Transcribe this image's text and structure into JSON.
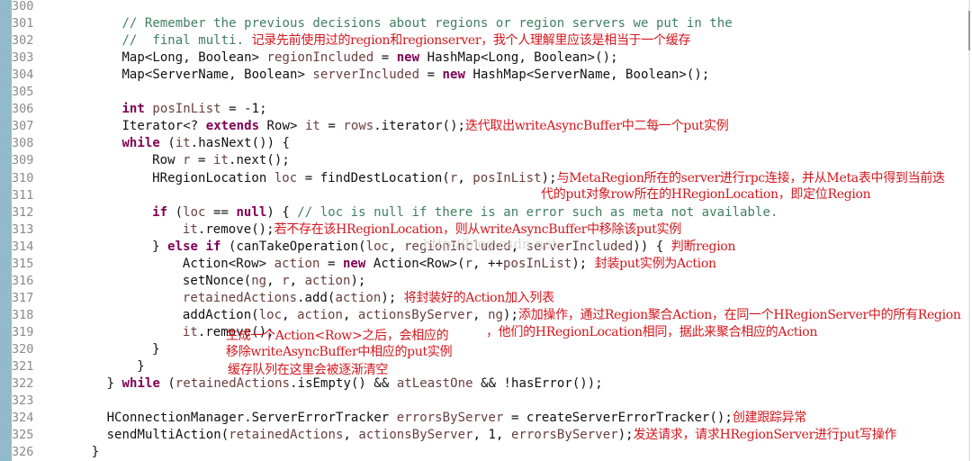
{
  "editor": {
    "watermark": "http://blog.csdn.net",
    "colors": {
      "keyword": "#7f0055",
      "comment": "#3f7f5f",
      "local_variable": "#6a3e3e",
      "annotation": "#d4161c",
      "line_number": "#8a8a8a"
    },
    "lines": [
      {
        "n": "300"
      },
      {
        "n": "301",
        "indent": "    ",
        "segs": [
          {
            "t": "// Remember the previous decisions about regions or region servers we put in the",
            "c": "cm"
          }
        ]
      },
      {
        "n": "302",
        "indent": "    ",
        "segs": [
          {
            "t": "//  final multi. ",
            "c": "cm"
          },
          {
            "t": "记录先前使用过的region和regionserver，我个人理解里应该是相当于一个缓存",
            "c": "note"
          }
        ]
      },
      {
        "n": "303",
        "indent": "    ",
        "segs": [
          {
            "t": "Map<Long, Boolean> "
          },
          {
            "t": "regionIncluded",
            "c": "var"
          },
          {
            "t": " = "
          },
          {
            "t": "new",
            "c": "kw"
          },
          {
            "t": " HashMap<Long, Boolean>();"
          }
        ]
      },
      {
        "n": "304",
        "indent": "    ",
        "segs": [
          {
            "t": "Map<ServerName, Boolean> "
          },
          {
            "t": "serverIncluded",
            "c": "var"
          },
          {
            "t": " = "
          },
          {
            "t": "new",
            "c": "kw"
          },
          {
            "t": " HashMap<ServerName, Boolean>();"
          }
        ]
      },
      {
        "n": "305"
      },
      {
        "n": "306",
        "indent": "    ",
        "segs": [
          {
            "t": "int",
            "c": "kw"
          },
          {
            "t": " "
          },
          {
            "t": "posInList",
            "c": "var"
          },
          {
            "t": " = -1;"
          }
        ]
      },
      {
        "n": "307",
        "indent": "    ",
        "segs": [
          {
            "t": "Iterator<? "
          },
          {
            "t": "extends",
            "c": "kw"
          },
          {
            "t": " Row> "
          },
          {
            "t": "it",
            "c": "var"
          },
          {
            "t": " = "
          },
          {
            "t": "rows",
            "c": "var"
          },
          {
            "t": ".iterator();"
          },
          {
            "t": "迭代取出writeAsyncBuffer中二每一个put实例",
            "c": "note"
          }
        ]
      },
      {
        "n": "308",
        "indent": "    ",
        "segs": [
          {
            "t": "while",
            "c": "kw"
          },
          {
            "t": " ("
          },
          {
            "t": "it",
            "c": "var"
          },
          {
            "t": ".hasNext()) {"
          }
        ]
      },
      {
        "n": "309",
        "indent": "      ",
        "segs": [
          {
            "t": "Row "
          },
          {
            "t": "r",
            "c": "var"
          },
          {
            "t": " = "
          },
          {
            "t": "it",
            "c": "var"
          },
          {
            "t": ".next();"
          }
        ]
      },
      {
        "n": "310",
        "indent": "      ",
        "segs": [
          {
            "t": "HRegionLocation "
          },
          {
            "t": "loc",
            "c": "var"
          },
          {
            "t": " = findDestLocation("
          },
          {
            "t": "r",
            "c": "var"
          },
          {
            "t": ", "
          },
          {
            "t": "posInList",
            "c": "var"
          },
          {
            "t": ");"
          },
          {
            "t": "与MetaRegion所在的server进行rpc连接，并从Meta表中得到当前迭",
            "c": "note"
          }
        ]
      },
      {
        "n": "311"
      },
      {
        "n": "312",
        "indent": "      ",
        "segs": [
          {
            "t": "if",
            "c": "kw"
          },
          {
            "t": " ("
          },
          {
            "t": "loc",
            "c": "var"
          },
          {
            "t": " == "
          },
          {
            "t": "null",
            "c": "kw"
          },
          {
            "t": ") { "
          },
          {
            "t": "// loc is null if there is an error such as meta not available.",
            "c": "cm"
          }
        ]
      },
      {
        "n": "313",
        "indent": "        ",
        "segs": [
          {
            "t": "it",
            "c": "var"
          },
          {
            "t": ".remove();"
          },
          {
            "t": "若不存在该HRegionLocation，则从writeAsyncBuffer中移除该put实例",
            "c": "note"
          }
        ]
      },
      {
        "n": "314",
        "indent": "      ",
        "segs": [
          {
            "t": "} "
          },
          {
            "t": "else if",
            "c": "kw"
          },
          {
            "t": " (canTakeOperation("
          },
          {
            "t": "loc",
            "c": "var"
          },
          {
            "t": ", "
          },
          {
            "t": "regionIncluded",
            "c": "var"
          },
          {
            "t": ", "
          },
          {
            "t": "serverIncluded",
            "c": "var"
          },
          {
            "t": ")) { "
          },
          {
            "t": "判断region",
            "c": "note"
          }
        ]
      },
      {
        "n": "315",
        "indent": "        ",
        "segs": [
          {
            "t": "Action<Row> "
          },
          {
            "t": "action",
            "c": "var"
          },
          {
            "t": " = "
          },
          {
            "t": "new",
            "c": "kw"
          },
          {
            "t": " Action<Row>("
          },
          {
            "t": "r",
            "c": "var"
          },
          {
            "t": ", ++"
          },
          {
            "t": "posInList",
            "c": "var"
          },
          {
            "t": "); "
          },
          {
            "t": "封装put实例为Action",
            "c": "note"
          }
        ]
      },
      {
        "n": "316",
        "indent": "        ",
        "segs": [
          {
            "t": "setNonce("
          },
          {
            "t": "ng",
            "c": "var"
          },
          {
            "t": ", "
          },
          {
            "t": "r",
            "c": "var"
          },
          {
            "t": ", "
          },
          {
            "t": "action",
            "c": "var"
          },
          {
            "t": ");"
          }
        ]
      },
      {
        "n": "317",
        "indent": "        ",
        "segs": [
          {
            "t": "retainedActions",
            "c": "var"
          },
          {
            "t": ".add("
          },
          {
            "t": "action",
            "c": "var"
          },
          {
            "t": "); "
          },
          {
            "t": "将封装好的Action加入列表",
            "c": "note"
          }
        ]
      },
      {
        "n": "318",
        "indent": "        ",
        "segs": [
          {
            "t": "addAction("
          },
          {
            "t": "loc",
            "c": "var"
          },
          {
            "t": ", "
          },
          {
            "t": "action",
            "c": "var"
          },
          {
            "t": ", "
          },
          {
            "t": "actionsByServer",
            "c": "var"
          },
          {
            "t": ", "
          },
          {
            "t": "ng",
            "c": "var"
          },
          {
            "t": ");"
          },
          {
            "t": "添加操作，通过Region聚合Action，在同一个HRegionServer中的所有Region",
            "c": "note"
          }
        ]
      },
      {
        "n": "319",
        "indent": "        ",
        "segs": [
          {
            "t": "it",
            "c": "var"
          },
          {
            "t": ".remove();"
          }
        ]
      },
      {
        "n": "320",
        "indent": "      ",
        "segs": [
          {
            "t": "}"
          }
        ]
      },
      {
        "n": "321",
        "indent": "     ",
        "segs": [
          {
            "t": "}"
          }
        ]
      },
      {
        "n": "322",
        "indent": "   ",
        "segs": [
          {
            "t": "} "
          },
          {
            "t": "while",
            "c": "kw"
          },
          {
            "t": " ("
          },
          {
            "t": "retainedActions",
            "c": "var"
          },
          {
            "t": ".isEmpty() && "
          },
          {
            "t": "atLeastOne",
            "c": "var"
          },
          {
            "t": " && !hasError());"
          }
        ]
      },
      {
        "n": "323"
      },
      {
        "n": "324",
        "indent": "   ",
        "segs": [
          {
            "t": "HConnectionManager.ServerErrorTracker "
          },
          {
            "t": "errorsByServer",
            "c": "var"
          },
          {
            "t": " = createServerErrorTracker();"
          },
          {
            "t": "创建跟踪异常",
            "c": "note"
          }
        ]
      },
      {
        "n": "325",
        "indent": "   ",
        "segs": [
          {
            "t": "sendMultiAction("
          },
          {
            "t": "retainedActions",
            "c": "var"
          },
          {
            "t": ", "
          },
          {
            "t": "actionsByServer",
            "c": "var"
          },
          {
            "t": ", 1, "
          },
          {
            "t": "errorsByServer",
            "c": "var"
          },
          {
            "t": ");"
          },
          {
            "t": "发送请求，请求HRegionServer进行put写操作",
            "c": "note"
          }
        ]
      },
      {
        "n": "326",
        "indent": "  ",
        "segs": [
          {
            "t": "}"
          }
        ]
      }
    ],
    "floating_notes": {
      "line310_cont": "代的put对象row所在的HRegionLocation，即定位Region",
      "line318_cont": "，他们的HRegionLocation相同，据此来聚合相应的Action",
      "line319_a": "生成一个Action<Row>之后，会相应的",
      "line319_b": "移除writeAsyncBuffer中相应的put实例",
      "line319_c": "缓存队列在这里会被逐渐清空"
    }
  }
}
